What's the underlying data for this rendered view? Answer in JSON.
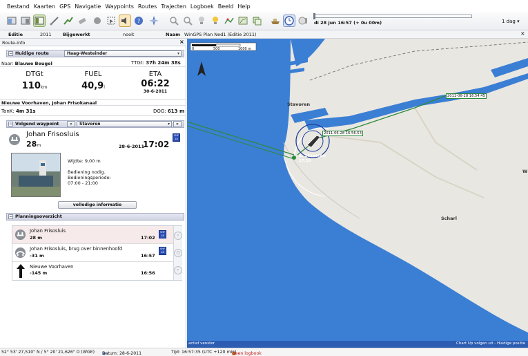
{
  "menu": [
    "Bestand",
    "Kaarten",
    "GPS",
    "Navigatie",
    "Waypoints",
    "Routes",
    "Trajecten",
    "Logboek",
    "Beeld",
    "Help"
  ],
  "toolbar": {
    "datetime": "di 28 jun 16:57",
    "offset": "(+ 0u 00m)",
    "range": "1 dag"
  },
  "infobar": {
    "edition_label": "Editie",
    "edition_value": "2011",
    "updated_label": "Bijgewerkt",
    "updated_value": "nooit",
    "name_label": "Naam",
    "name_value": "WinGPS Plan Ned1 (Editie 2011)",
    "close": "×"
  },
  "panel": {
    "title": "Route-info",
    "close": "×",
    "current_route_label": "Huidige route",
    "current_route_value": "Haag-Westeinder",
    "to_label": "Naar:",
    "to_value": "Blauwe Beugel",
    "ttgt_label": "TTGt:",
    "ttgt_value": "37h 24m 38s",
    "dtgt_label": "DTGt",
    "dtgt_value": "110",
    "dtgt_unit": "km",
    "fuel_label": "FUEL",
    "fuel_value": "40,9",
    "fuel_unit": "l",
    "eta_label": "ETA",
    "eta_time": "06:22",
    "eta_date": "30-6-2011",
    "segment": "Nieuwe Voorhaven, Johan Frisokanaal",
    "tonk_label": "TonK:",
    "tonk_value": "4m 31s",
    "dog_label": "DOG:",
    "dog_value": "613 m",
    "next_wp_label": "Volgend waypoint",
    "next_wp_value": "Stavoren",
    "nav_prev": "«",
    "nav_next": "»",
    "wp_name": "Johan Frisosluis",
    "wp_dist": "28",
    "wp_dist_unit": "m",
    "wp_date": "28-6-2011",
    "wp_time": "17:02",
    "vhf_top": "VHF",
    "vhf_ch": "18",
    "width_text": "Wijdte: 9,00 m",
    "operation_text": "Bediening nodig.",
    "period_label": "Bedieningsperiode:",
    "period_value": "07:00 - 21:00",
    "more_info": "volledige informatie",
    "planning_label": "Planningsoverzicht"
  },
  "planning": [
    {
      "name": "Johan Frisosluis",
      "dist": "28 m",
      "time": "17:02",
      "vhf": "18"
    },
    {
      "name": "Johan Frisosluis, brug over binnenhoofd",
      "dist": "-31 m",
      "time": "16:57",
      "vhf": "18"
    },
    {
      "name": "Nieuwe Voorhaven",
      "dist": "-145 m",
      "time": "16:56",
      "vhf": ""
    }
  ],
  "map": {
    "scale": [
      "0",
      "500",
      "1000 m"
    ],
    "place_stavoren": "Stavoren",
    "place_scharl": "Scharl",
    "place_w": "W",
    "wp_label": "2. Stavoren",
    "wp_eta": "17:19",
    "track_tag_1": "2011-06-28 16.56.53",
    "track_tag_2": "2011-06-28 16.54.45",
    "active_window": "actief venster",
    "chart_mode": "Chart Up volgen uit - Huidige positie",
    "water_color": "#3b7fd4",
    "land_color": "#e9e7e1"
  },
  "status": {
    "position": "52° 53' 27,510\" N / 5° 20' 21,626\" O (WGE)",
    "datum": "Datum: 28-6-2011",
    "time": "Tijd: 16:57:35 (UTC +120 min)",
    "logbook": "Geen logbook"
  }
}
